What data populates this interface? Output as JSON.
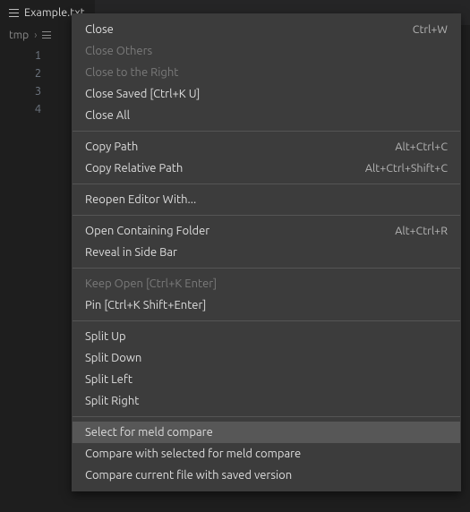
{
  "tab": {
    "title": "Example.txt"
  },
  "breadcrumb": {
    "seg1": "tmp",
    "chev": "›"
  },
  "gutter": {
    "l1": "1",
    "l2": "2",
    "l3": "3",
    "l4": "4"
  },
  "menu": {
    "close": {
      "label": "Close",
      "accel": "Ctrl+W"
    },
    "close_others": {
      "label": "Close Others",
      "accel": ""
    },
    "close_right": {
      "label": "Close to the Right",
      "accel": ""
    },
    "close_saved": {
      "label": "Close Saved [Ctrl+K U]",
      "accel": ""
    },
    "close_all": {
      "label": "Close All",
      "accel": ""
    },
    "copy_path": {
      "label": "Copy Path",
      "accel": "Alt+Ctrl+C"
    },
    "copy_rel_path": {
      "label": "Copy Relative Path",
      "accel": "Alt+Ctrl+Shift+C"
    },
    "reopen_with": {
      "label": "Reopen Editor With...",
      "accel": ""
    },
    "open_folder": {
      "label": "Open Containing Folder",
      "accel": "Alt+Ctrl+R"
    },
    "reveal_sidebar": {
      "label": "Reveal in Side Bar",
      "accel": ""
    },
    "keep_open": {
      "label": "Keep Open [Ctrl+K Enter]",
      "accel": ""
    },
    "pin": {
      "label": "Pin [Ctrl+K Shift+Enter]",
      "accel": ""
    },
    "split_up": {
      "label": "Split Up",
      "accel": ""
    },
    "split_down": {
      "label": "Split Down",
      "accel": ""
    },
    "split_left": {
      "label": "Split Left",
      "accel": ""
    },
    "split_right": {
      "label": "Split Right",
      "accel": ""
    },
    "meld_select": {
      "label": "Select for meld compare",
      "accel": ""
    },
    "meld_compare_sel": {
      "label": "Compare with selected for meld compare",
      "accel": ""
    },
    "meld_compare_sav": {
      "label": "Compare current file with saved version",
      "accel": ""
    }
  }
}
